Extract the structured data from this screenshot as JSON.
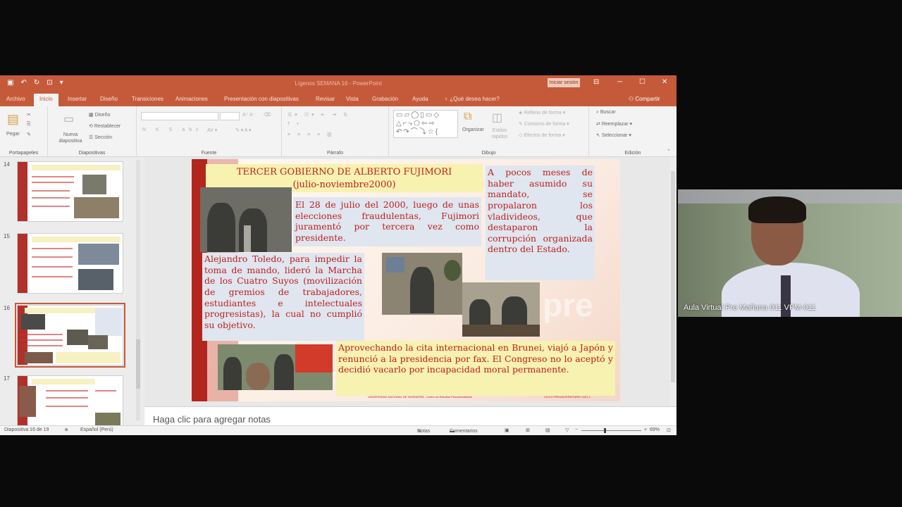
{
  "window": {
    "title": "Lígenos SEMANA 16 - PowerPoint",
    "signin": "Iniciar sesión",
    "controls": {
      "restore_icon": "ribbon-display-icon",
      "minimize": "─",
      "maximize": "☐",
      "close": "✕"
    }
  },
  "tabs": [
    "Archivo",
    "Inicio",
    "Insertar",
    "Diseño",
    "Transiciones",
    "Animaciones",
    "Presentación con diapositivas",
    "Revisar",
    "Vista",
    "Grabación",
    "Ayuda",
    "¿Qué desea hacer?"
  ],
  "active_tab": "Inicio",
  "share_label": "Compartir",
  "ribbon": {
    "groups": [
      "Portapapeles",
      "Diapositivas",
      "Fuente",
      "Párrafo",
      "Dibujo",
      "Edición"
    ],
    "paste": "Pegar",
    "new_slide": "Nueva diapositiva",
    "layout": "Diseño",
    "reset": "Restablecer",
    "section": "Sección",
    "arrange": "Organizar",
    "quick_styles": "Estilos rápidos",
    "shape_fill": "Relleno de forma",
    "shape_outline": "Contorno de forma",
    "shape_effects": "Efectos de forma",
    "find": "Buscar",
    "replace": "Reemplazar",
    "select": "Seleccionar"
  },
  "thumbnails": [
    {
      "number": "14",
      "selected": false
    },
    {
      "number": "15",
      "selected": false
    },
    {
      "number": "16",
      "selected": true
    },
    {
      "number": "17",
      "selected": false
    }
  ],
  "slide": {
    "title_line1": "TERCER GOBIERNO DE ALBERTO FUJIMORI",
    "title_line2": "(julio-noviembre2000)",
    "box_july": "El 28 de julio del 2000, luego de unas elecciones fraudulentas, Fujimori juramentó por tercera vez como presidente.",
    "box_right": "A pocos meses de haber asumido su mandato, se propalaron los vladivideos, que destaparon la corrupción organizada dentro del Estado.",
    "box_toledo": "Alejandro Toledo, para impedir la toma de mando, lideró la Marcha de los Cuatro Suyos (movilización de gremios de trabajadores, estudiantes e intelectuales progresistas), la cual no cumplió su objetivo.",
    "box_brunei": "Aprovechando la cita internacional en Brunei, viajó a Japón y renunció a la presidencia por fax. El Congreso no lo aceptó y decidió vacarlo por incapacidad moral permanente.",
    "watermark": "pre",
    "footer_left": "UNIVERSIDAD NACIONAL DE INGENIERÍA - Centro de Estudios Preuniversitarios",
    "footer_right": "CICLO PREUNIVERSITARIO 2021-1"
  },
  "notes_placeholder": "Haga clic para agregar notas",
  "status": {
    "slide_info": "Diapositiva 16 de 19",
    "language": "Español (Perú)",
    "notes": "Notas",
    "comments": "Comentarios",
    "zoom": "69%"
  },
  "webcam": {
    "participant_name": "Aula Virtual Pre Mañana 011 VPM-011"
  }
}
